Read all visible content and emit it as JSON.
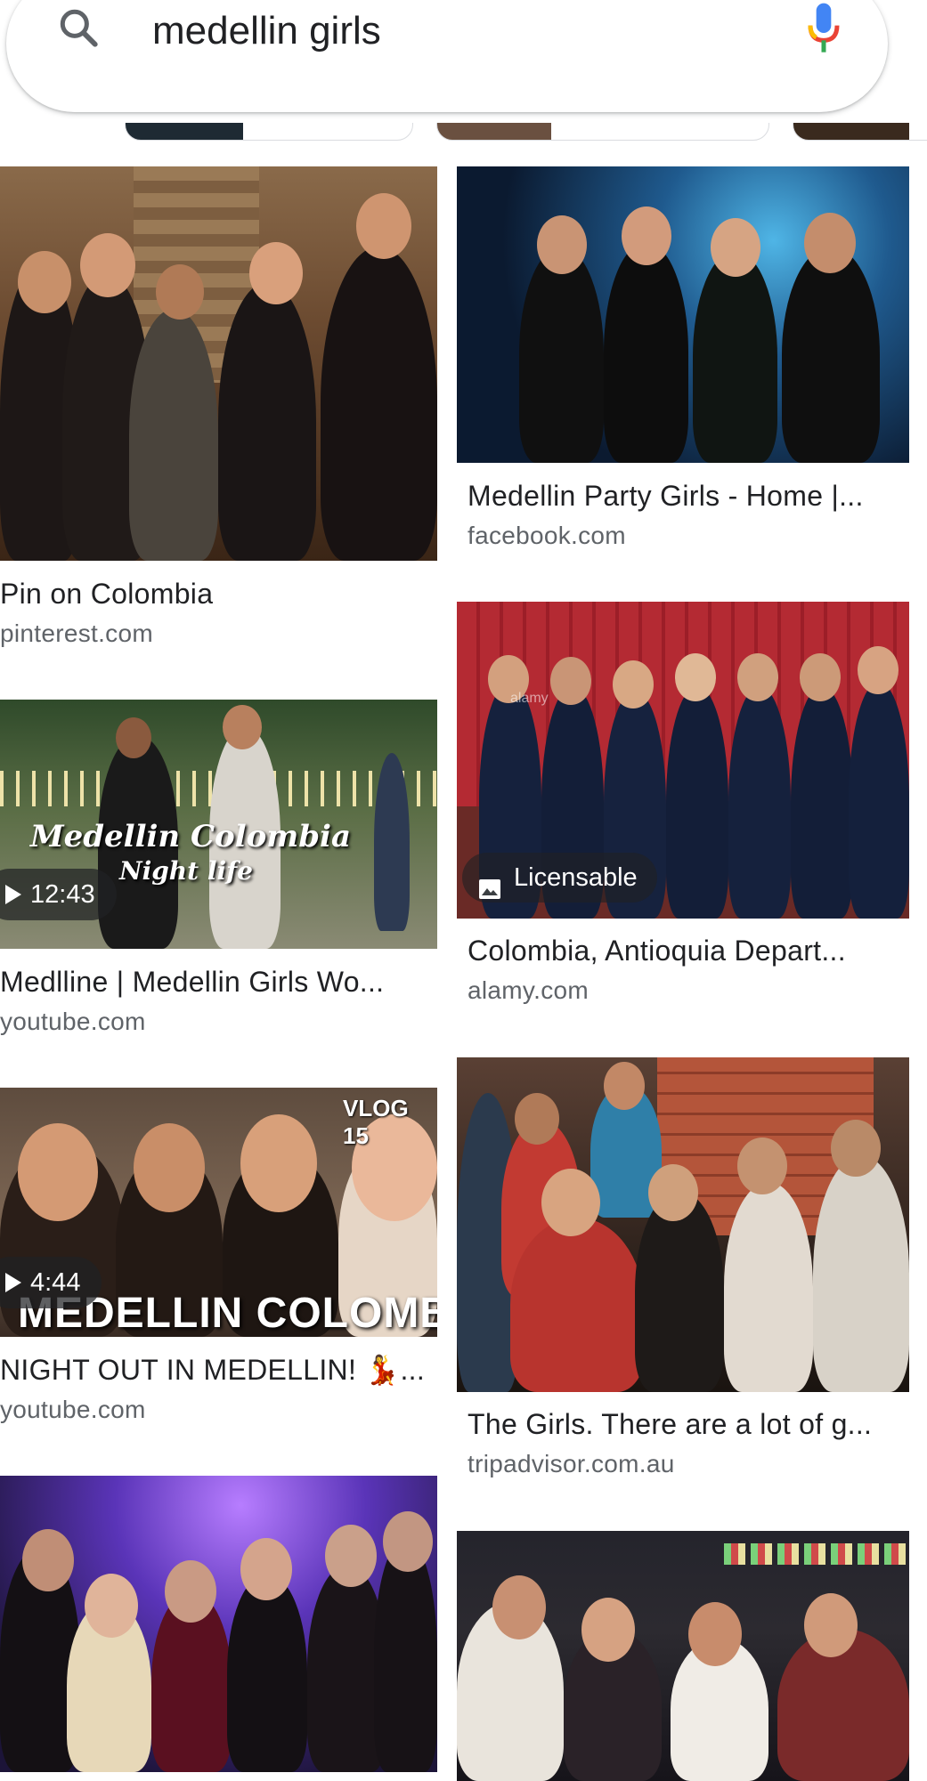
{
  "search": {
    "query": "medellin girls",
    "search_icon": "search-icon",
    "mic_icon": "mic-icon"
  },
  "results": [
    {
      "title": "Pin on Colombia",
      "source": "pinterest.com"
    },
    {
      "title": "Medellin Party Girls - Home |...",
      "source": "facebook.com"
    },
    {
      "title": "Medlline | Medellin Girls Wo...",
      "source": "youtube.com",
      "duration": "12:43",
      "overlay_line1": "Medellin Colombia",
      "overlay_line2": "Night life"
    },
    {
      "title": "Colombia, Antioquia Depart...",
      "source": "alamy.com",
      "badge": "Licensable",
      "watermark": "alamy"
    },
    {
      "title": "NIGHT OUT IN MEDELLIN! 💃...",
      "source": "youtube.com",
      "duration": "4:44",
      "overlay_top": "VLOG 15",
      "overlay_caption": "MEDELLIN COLOMBIA"
    },
    {
      "title": "The Girls. There are a lot of g...",
      "source": "tripadvisor.com.au"
    }
  ],
  "colors": {
    "accent_blue": "#4285F4",
    "accent_red": "#EA4335",
    "accent_yellow": "#FBBC05",
    "accent_green": "#34A853",
    "text_primary": "#202124",
    "text_secondary": "#5f6368"
  }
}
